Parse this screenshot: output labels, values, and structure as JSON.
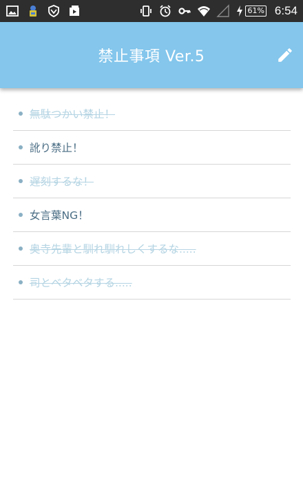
{
  "status_bar": {
    "battery": "61%",
    "time": "6:54"
  },
  "app_bar": {
    "title": "禁止事項 Ver.5"
  },
  "rules": [
    {
      "text": "無駄つかい禁止！",
      "done": true
    },
    {
      "text": "訛り禁止！",
      "done": false
    },
    {
      "text": "遅刻するな！",
      "done": true
    },
    {
      "text": "女言葉NG！",
      "done": false
    },
    {
      "text": "奥寺先輩と馴れ馴れしくするな.....",
      "done": true
    },
    {
      "text": "司とベタベタする.....",
      "done": true
    }
  ],
  "colors": {
    "app_bar": "#84c6ec",
    "active_text": "#4a6d84",
    "done_text": "#b4d4e3"
  },
  "icons": {
    "edit": "pencil-icon"
  }
}
